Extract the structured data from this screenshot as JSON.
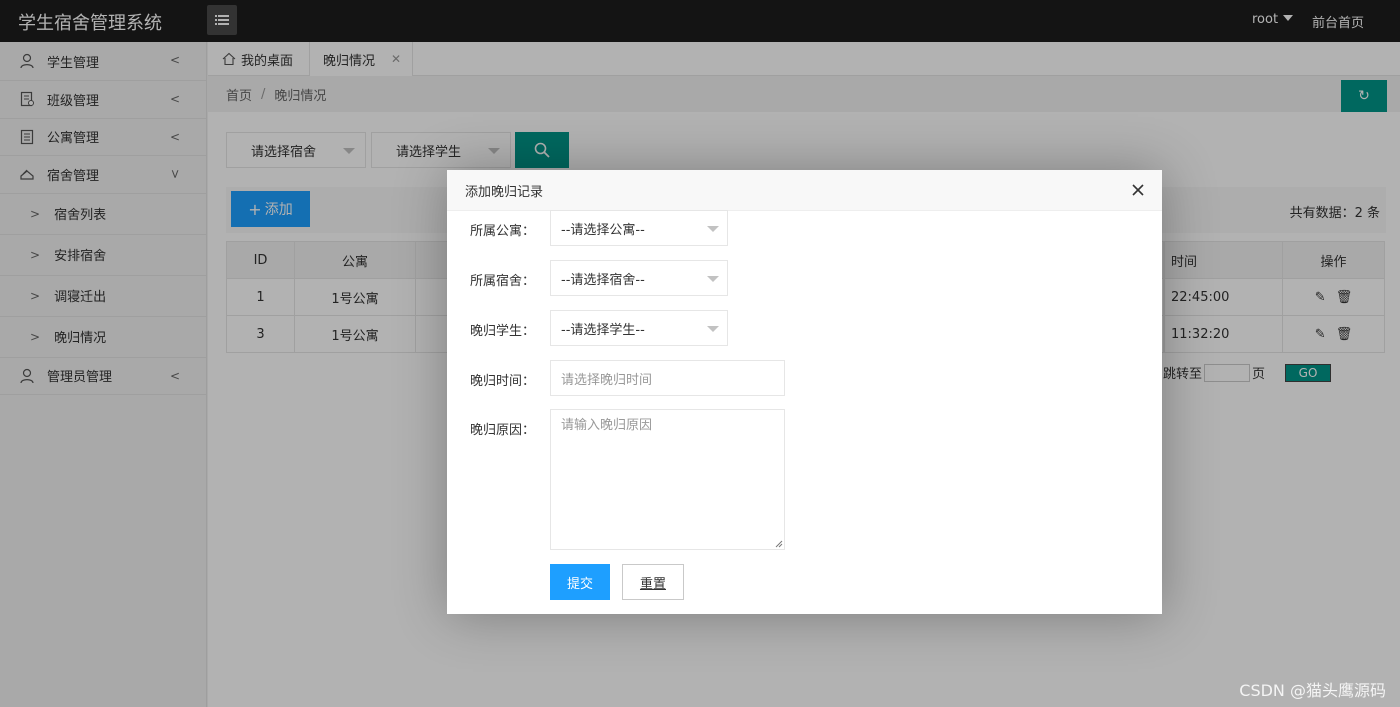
{
  "app": {
    "title": "学生宿舍管理系统"
  },
  "header": {
    "user": "root",
    "front_page": "前台首页"
  },
  "sidebar": {
    "items": [
      {
        "label": "学生管理",
        "icon": "user-icon"
      },
      {
        "label": "班级管理",
        "icon": "class-icon"
      },
      {
        "label": "公寓管理",
        "icon": "building-icon"
      },
      {
        "label": "宿舍管理",
        "icon": "bed-icon",
        "expanded": true
      },
      {
        "label": "管理员管理",
        "icon": "admin-icon"
      }
    ],
    "sub_items": [
      {
        "label": "宿舍列表"
      },
      {
        "label": "安排宿舍"
      },
      {
        "label": "调寝迁出"
      },
      {
        "label": "晚归情况"
      }
    ]
  },
  "tabs": {
    "home": "我的桌面",
    "active": "晚归情况"
  },
  "breadcrumb": {
    "home": "首页",
    "current": "晚归情况"
  },
  "filters": {
    "dorm_select": "请选择宿舍",
    "student_select": "请选择学生"
  },
  "toolbar": {
    "add_label": "添加",
    "total": "共有数据：2 条"
  },
  "table": {
    "headers": {
      "id": "ID",
      "apartment": "公寓",
      "time": "时间",
      "actions": "操作"
    },
    "rows": [
      {
        "id": "1",
        "apartment": "1号公寓",
        "time": "22:45:00"
      },
      {
        "id": "3",
        "apartment": "1号公寓",
        "time": "11:32:20"
      }
    ]
  },
  "pager": {
    "jump_label": "跳转至",
    "page_label": "页",
    "go_label": "GO"
  },
  "dialog": {
    "title": "添加晚归记录",
    "fields": {
      "apartment_label": "所属公寓：",
      "apartment_value": "--请选择公寓--",
      "dorm_label": "所属宿舍：",
      "dorm_value": "--请选择宿舍--",
      "student_label": "晚归学生：",
      "student_value": "--请选择学生--",
      "time_label": "晚归时间：",
      "time_placeholder": "请选择晚归时间",
      "reason_label": "晚归原因：",
      "reason_placeholder": "请输入晚归原因"
    },
    "submit_label": "提交",
    "reset_label": "重置"
  },
  "watermark": "CSDN @猫头鹰源码",
  "colors": {
    "primary": "#009688",
    "blue": "#1e9fff",
    "header_bg": "#1d1d1d"
  }
}
